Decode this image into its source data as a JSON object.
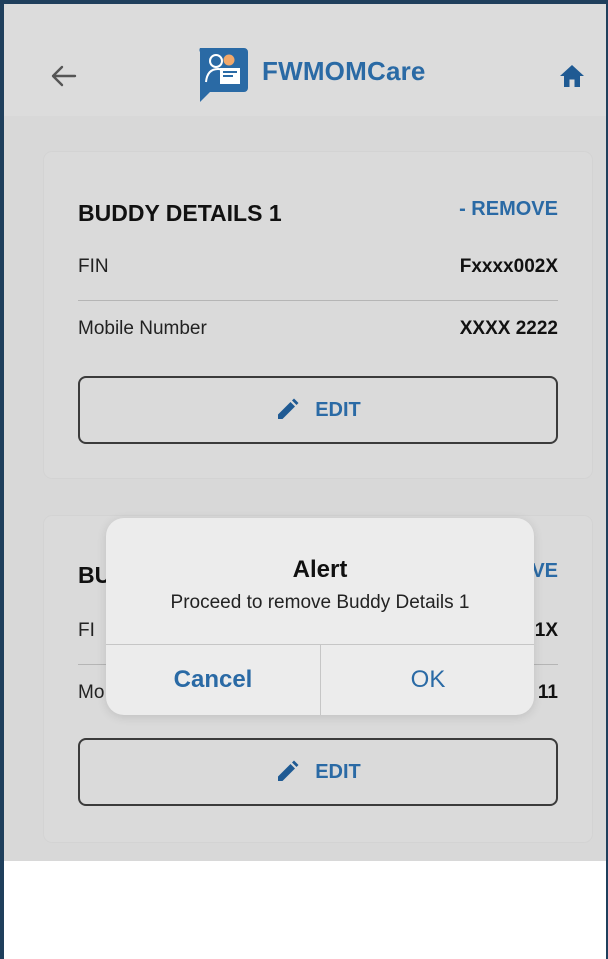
{
  "header": {
    "title": "FWMOMCare",
    "back_icon": "arrow-left-icon",
    "home_icon": "home-icon",
    "brand_color": "#2a6aa5"
  },
  "buddies": [
    {
      "title": "BUDDY DETAILS 1",
      "remove_label": "- REMOVE",
      "fin_label": "FIN",
      "fin_value": "Fxxxx002X",
      "mobile_label": "Mobile Number",
      "mobile_value": "XXXX 2222",
      "edit_label": "EDIT"
    },
    {
      "title_visible": "BU",
      "remove_visible": "VE",
      "fin_label_visible": "FI",
      "fin_value_visible": "1X",
      "mobile_label_visible": "Mo",
      "mobile_value_visible": "11",
      "edit_label": "EDIT"
    }
  ],
  "alert": {
    "title": "Alert",
    "message": "Proceed to remove Buddy Details 1",
    "cancel_label": "Cancel",
    "ok_label": "OK"
  }
}
